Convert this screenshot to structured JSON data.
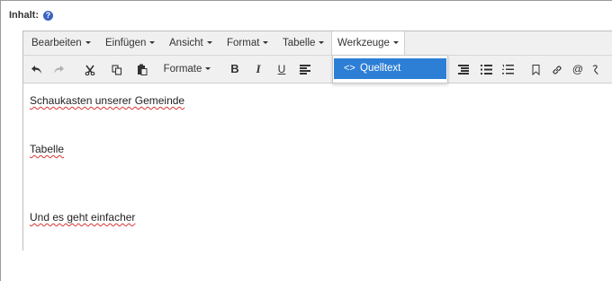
{
  "field": {
    "label": "Inhalt:",
    "help_icon": "info-circle-icon",
    "help_symbol": "?"
  },
  "menubar": {
    "items": [
      {
        "label": "Bearbeiten"
      },
      {
        "label": "Einfügen"
      },
      {
        "label": "Ansicht"
      },
      {
        "label": "Format"
      },
      {
        "label": "Tabelle"
      },
      {
        "label": "Werkzeuge"
      }
    ]
  },
  "toolbar": {
    "formats_label": "Formate",
    "bold_label": "B",
    "italic_label": "I",
    "underline_label": "U",
    "mention_label": "@"
  },
  "dropdown": {
    "item_icon": "<>",
    "item_label": "Quelltext"
  },
  "content": {
    "paragraphs": [
      "Schaukasten unserer Gemeinde",
      "Tabelle",
      "Und es geht einfacher"
    ]
  },
  "colors": {
    "accent": "#2d7fd6",
    "help_icon": "#3a63c2",
    "spellcheck": "#d93434"
  }
}
